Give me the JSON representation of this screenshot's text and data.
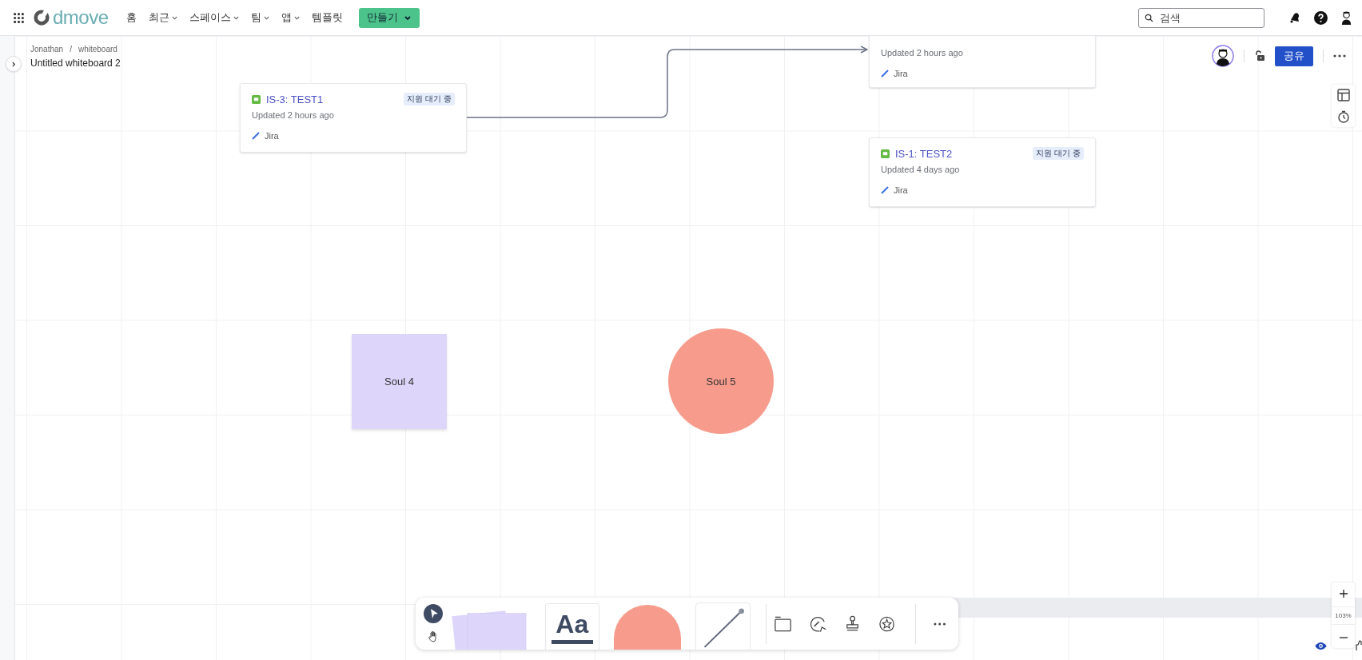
{
  "app": {
    "logo": "dmove"
  },
  "nav": [
    {
      "label": "홈",
      "dropdown": false
    },
    {
      "label": "최근",
      "dropdown": true
    },
    {
      "label": "스페이스",
      "dropdown": true
    },
    {
      "label": "팀",
      "dropdown": true
    },
    {
      "label": "앱",
      "dropdown": true
    },
    {
      "label": "템플릿",
      "dropdown": false
    }
  ],
  "create_button": "만들기",
  "search": {
    "placeholder": "검색"
  },
  "breadcrumb": [
    "Jonathan",
    "whiteboard"
  ],
  "breadcrumb_separator": "/",
  "board_title": "Untitled whiteboard 2",
  "share_button": "공유",
  "cards": [
    {
      "title": "IS-3: TEST1",
      "status": "지원 대기 중",
      "updated": "Updated 2 hours ago",
      "source": "Jira"
    },
    {
      "updated": "Updated 2 hours ago",
      "source": "Jira"
    },
    {
      "title": "IS-1: TEST2",
      "status": "지원 대기 중",
      "updated": "Updated 4 days ago",
      "source": "Jira"
    }
  ],
  "shapes": [
    {
      "kind": "sticky",
      "label": "Soul 4"
    },
    {
      "kind": "circle",
      "label": "Soul 5"
    }
  ],
  "toolbar": {
    "tools": [
      {
        "kind": "select",
        "selected": true
      },
      {
        "kind": "hand",
        "selected": false
      }
    ],
    "text_tool": "Aa"
  },
  "zoom": {
    "level_text": "103%"
  }
}
